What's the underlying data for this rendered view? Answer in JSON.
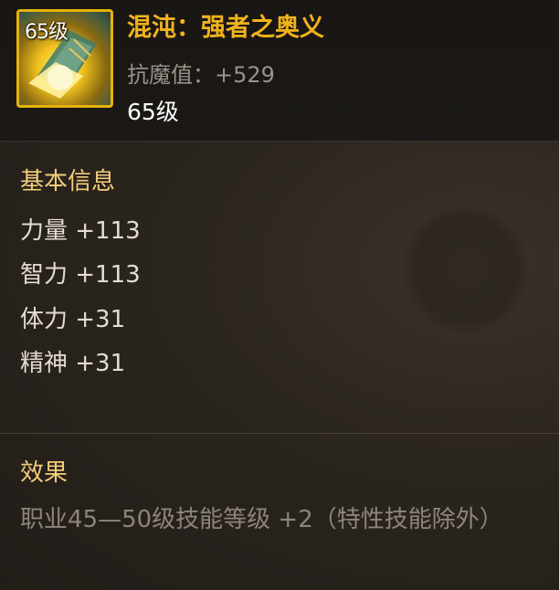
{
  "item": {
    "icon_level": "65级",
    "name": "混沌：强者之奥义",
    "resist": "抗魔值：+529",
    "level": "65级"
  },
  "basic_info": {
    "title": "基本信息",
    "stats": [
      "力量 +113",
      "智力 +113",
      "体力 +31",
      "精神 +31"
    ]
  },
  "effect": {
    "title": "效果",
    "text": "职业45—50级技能等级 +2（特性技能除外）"
  },
  "colors": {
    "name": "#f0b31c",
    "section_title": "#f3cd7a",
    "icon_border": "#e6b20a"
  },
  "icons": {
    "item_icon": "glowing-gold-book-icon"
  }
}
